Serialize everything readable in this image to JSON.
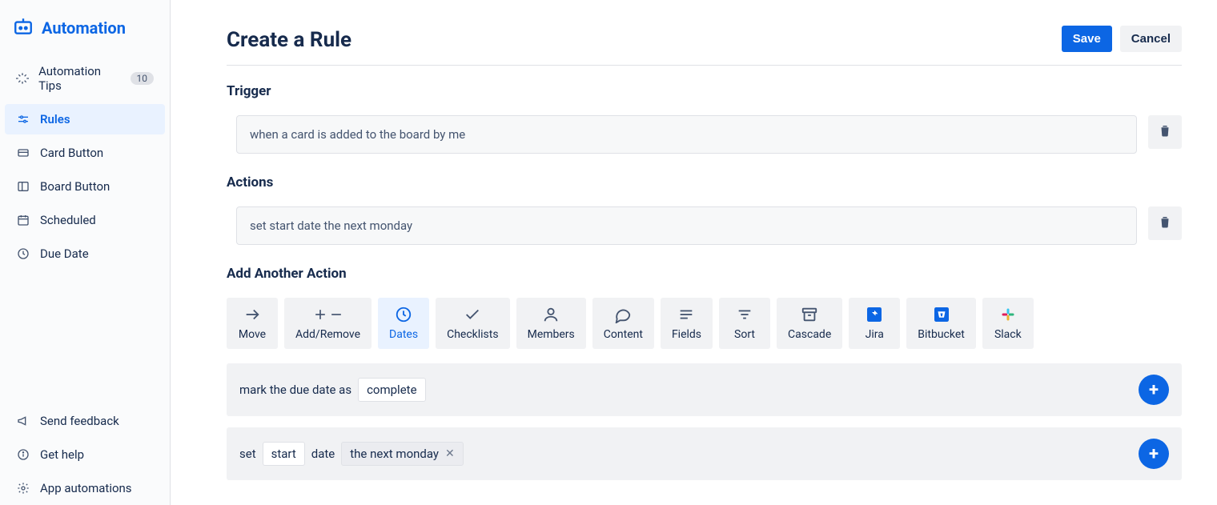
{
  "sidebar": {
    "appTitle": "Automation",
    "tipsLabel": "Automation Tips",
    "tipsBadge": "10",
    "items": [
      {
        "label": "Rules"
      },
      {
        "label": "Card Button"
      },
      {
        "label": "Board Button"
      },
      {
        "label": "Scheduled"
      },
      {
        "label": "Due Date"
      }
    ],
    "footer": [
      {
        "label": "Send feedback"
      },
      {
        "label": "Get help"
      },
      {
        "label": "App automations"
      }
    ]
  },
  "page": {
    "title": "Create a Rule",
    "saveLabel": "Save",
    "cancelLabel": "Cancel"
  },
  "trigger": {
    "heading": "Trigger",
    "text": "when a card is added to the board by me"
  },
  "actions": {
    "heading": "Actions",
    "rows": [
      {
        "text": "set start date the next monday"
      }
    ]
  },
  "addAnother": {
    "heading": "Add Another Action",
    "categories": [
      {
        "name": "Move"
      },
      {
        "name": "Add/Remove"
      },
      {
        "name": "Dates"
      },
      {
        "name": "Checklists"
      },
      {
        "name": "Members"
      },
      {
        "name": "Content"
      },
      {
        "name": "Fields"
      },
      {
        "name": "Sort"
      },
      {
        "name": "Cascade"
      },
      {
        "name": "Jira"
      },
      {
        "name": "Bitbucket"
      },
      {
        "name": "Slack"
      }
    ],
    "options": {
      "opt1": {
        "prefix": "mark the due date as",
        "chip": "complete"
      },
      "opt2": {
        "word1": "set",
        "chip1": "start",
        "word2": "date",
        "chip2": "the next monday"
      }
    }
  }
}
